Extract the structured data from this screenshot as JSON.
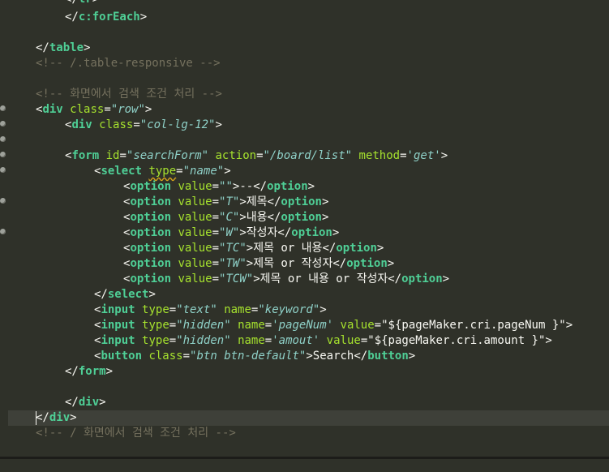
{
  "editor": {
    "lines": [
      "</tr>",
      "</c:forEach>",
      "",
      "</table>",
      "<!-- /.table-responsive -->",
      "",
      "<!-- 화면에서 검색 조건 처리 -->",
      "<div class=\"row\">",
      "<div class=\"col-lg-12\">",
      "",
      "<form id=\"searchForm\" action=\"/board/list\" method='get'>",
      "<select type=\"name\">",
      "<option value=\"\">--</option>",
      "<option value=\"T\">제목</option>",
      "<option value=\"C\">내용</option>",
      "<option value=\"W\">작성자</option>",
      "<option value=\"TC\">제목 or 내용</option>",
      "<option value=\"TW\">제목 or 작성자</option>",
      "<option value=\"TCW\">제목 or 내용 or 작성자</option>",
      "</select>",
      "<input type=\"text\" name=\"keyword\">",
      "<input type=\"hidden\" name='pageNum' value=\"${pageMaker.cri.pageNum }\">",
      "<input type=\"hidden\" name='amout' value=\"${pageMaker.cri.amount }\">",
      "<button class=\"btn btn-default\">Search</button>",
      "</form>",
      "",
      "</div>",
      "</div>",
      "<!-- / 화면에서 검색 조건 처리 -->"
    ],
    "texts": {
      "tr": "tr",
      "c_foreach": "c:forEach",
      "table": "table",
      "comment_table_responsive": "<!-- /.table-responsive -->",
      "comment_search": "<!-- 화면에서 검색 조건 처리 -->",
      "div": "div",
      "class": "class",
      "row_val": "\"row\"",
      "col_val": "\"col-lg-12\"",
      "form": "form",
      "id": "id",
      "searchform_val": "\"searchForm\"",
      "action": "action",
      "action_val": "\"/board/list\"",
      "method": "method",
      "method_val": "'get'",
      "select": "select",
      "type": "type",
      "name_val": "\"name\"",
      "option": "option",
      "value": "value",
      "v_empty": "\"\"",
      "v_T": "\"T\"",
      "v_C": "\"C\"",
      "v_W": "\"W\"",
      "v_TC": "\"TC\"",
      "v_TW": "\"TW\"",
      "v_TCW": "\"TCW\"",
      "o_dash": "--",
      "o_title": "제목",
      "o_content": "내용",
      "o_writer": "작성자",
      "o_tc": "제목 or 내용",
      "o_tw": "제목 or 작성자",
      "o_tcw": "제목 or 내용 or 작성자",
      "input": "input",
      "name": "name",
      "text_val": "\"text\"",
      "keyword_val": "\"keyword\"",
      "hidden_val": "\"hidden\"",
      "pagenum_val": "'pageNum'",
      "pagenum_expr": "\"${pageMaker.cri.pageNum }\"",
      "amout_val": "'amout'",
      "amount_expr": "\"${pageMaker.cri.amount }\"",
      "button": "button",
      "btn_val": "\"btn btn-default\"",
      "search_label": "Search",
      "comment_search_end": "<!-- / 화면에서 검색 조건 처리 -->"
    }
  },
  "colors": {
    "background": "#2f3129",
    "tag": "#4fcf96",
    "attribute": "#a6e22e",
    "value": "#8fd1c8",
    "comment": "#75715e",
    "text": "#f8f8f2",
    "current_line": "#3e4039"
  }
}
